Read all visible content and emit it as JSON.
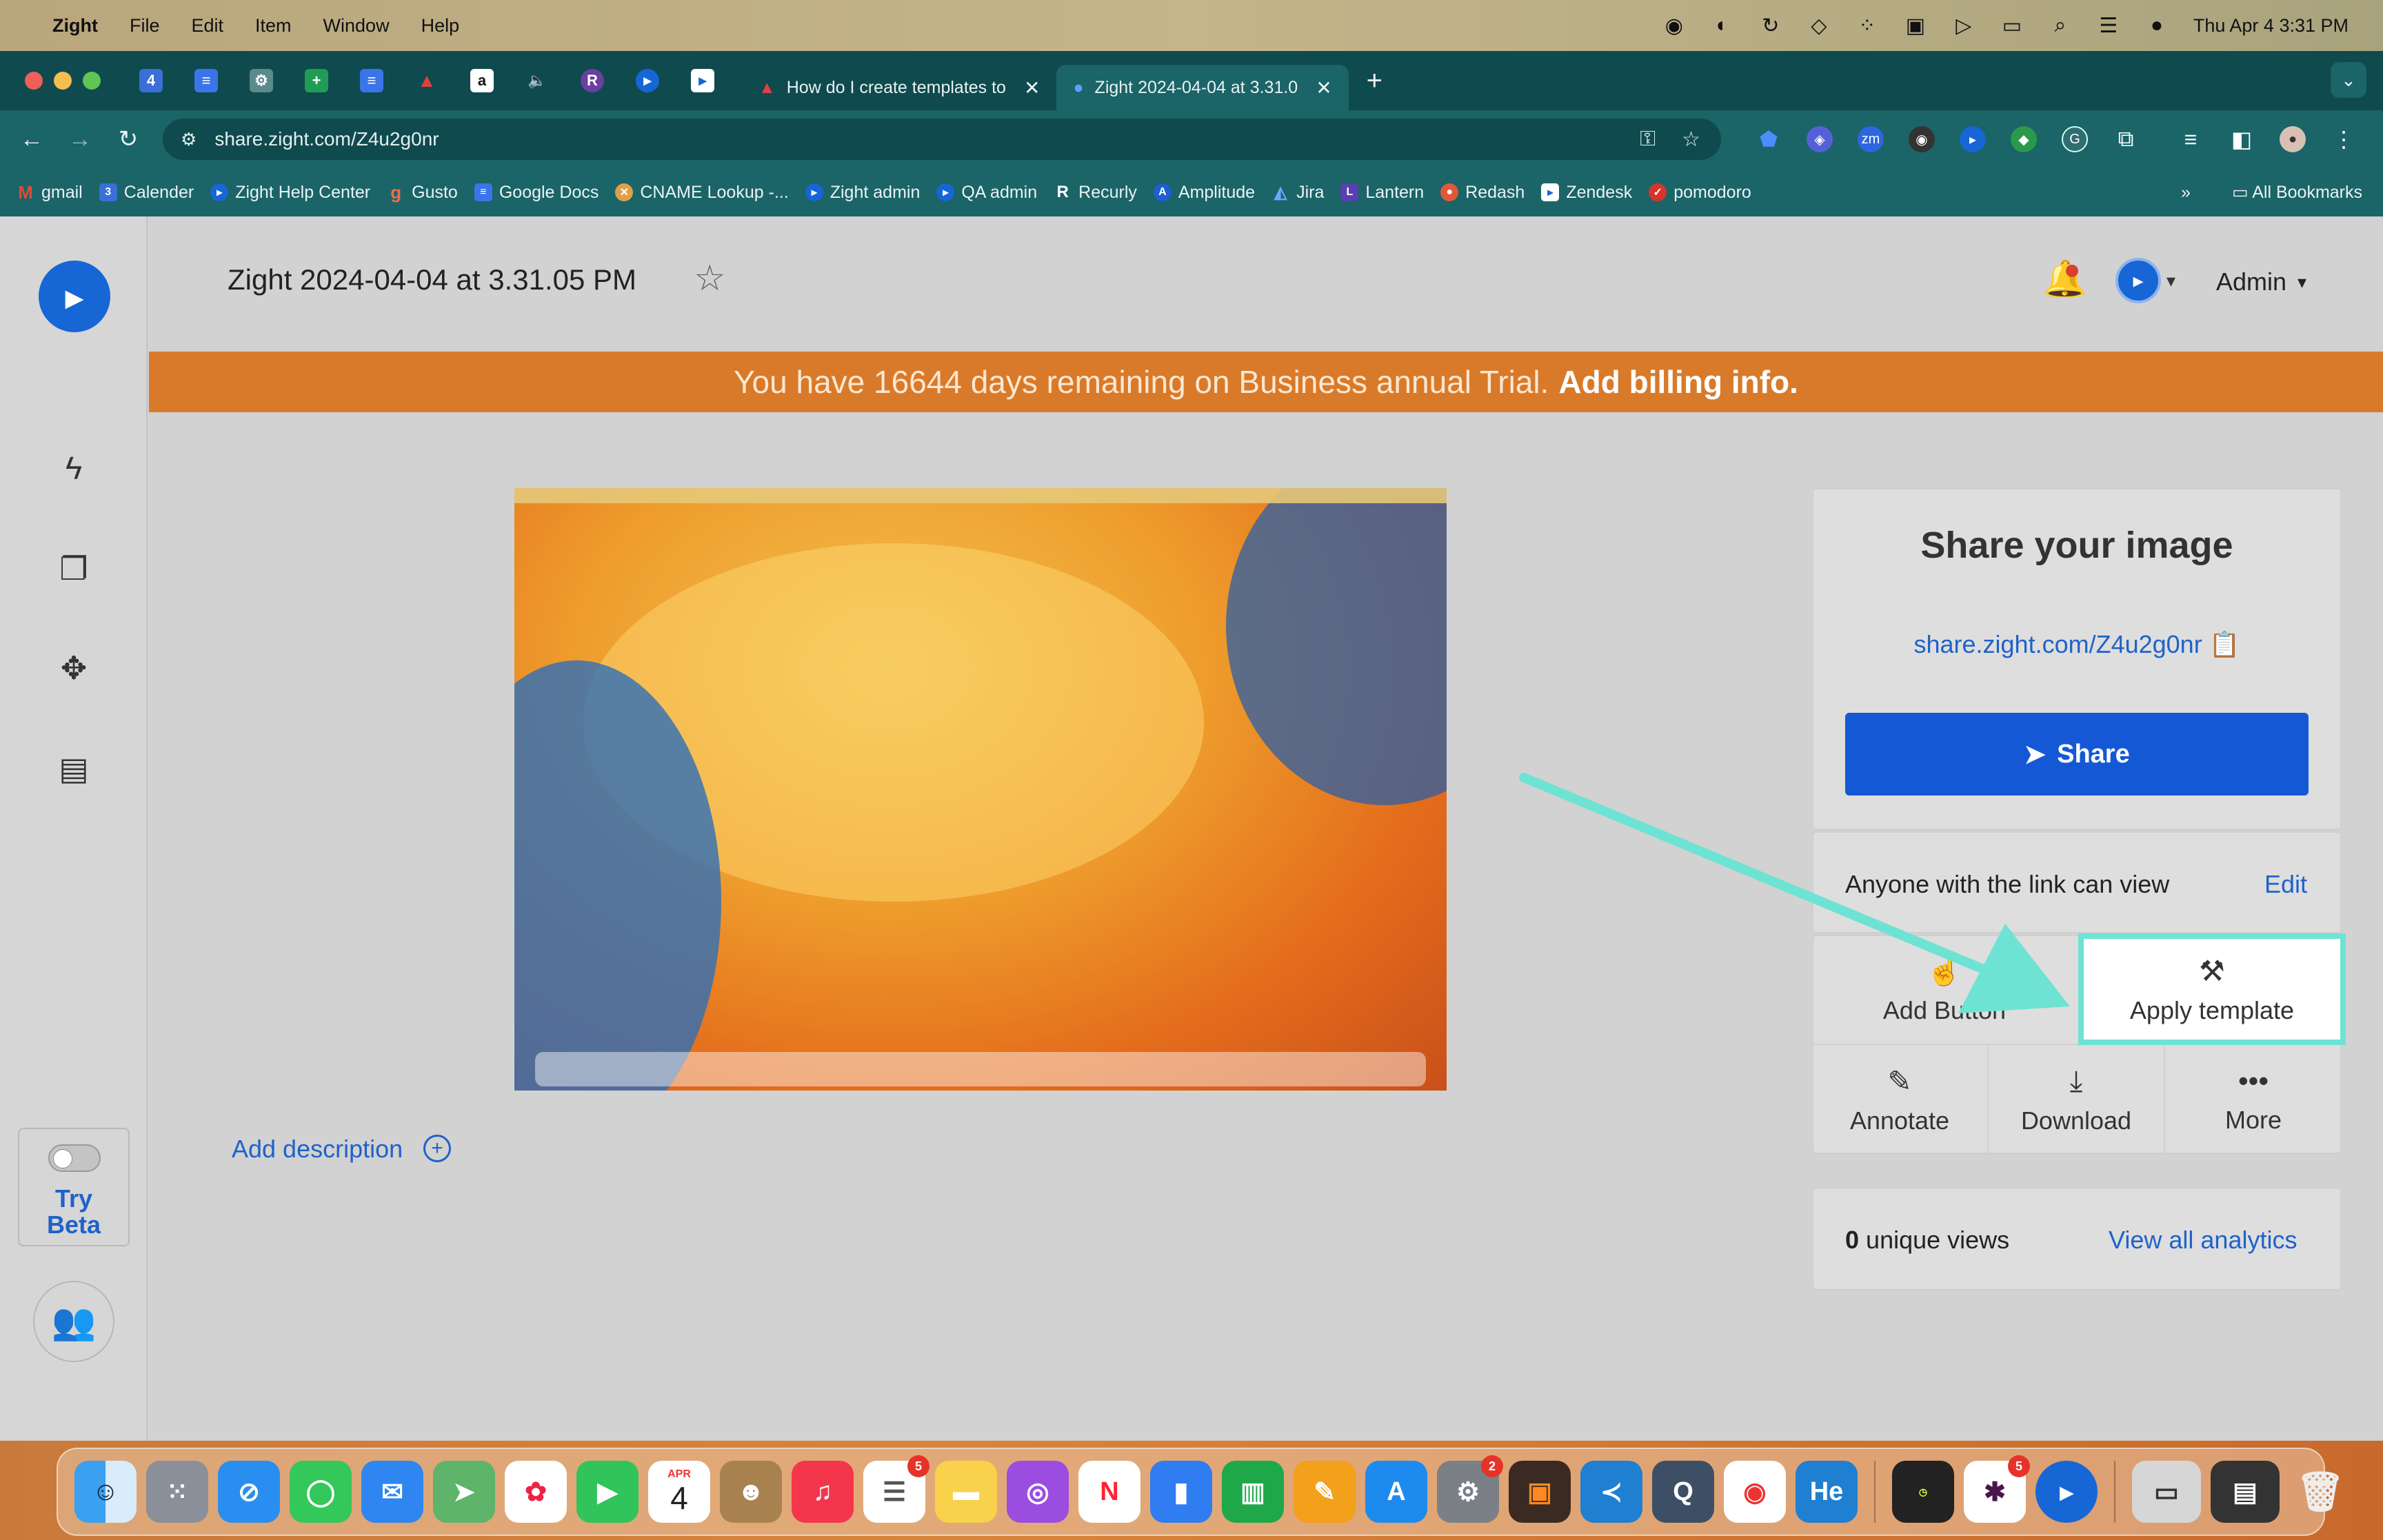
{
  "menubar": {
    "app_name": "Zight",
    "menus": [
      "File",
      "Edit",
      "Item",
      "Window",
      "Help"
    ],
    "datetime": "Thu Apr 4  3:31 PM"
  },
  "browser": {
    "tabs": [
      {
        "label": "How do I create templates to",
        "active": false
      },
      {
        "label": "Zight 2024-04-04 at 3.31.0",
        "active": true
      }
    ],
    "url": "share.zight.com/Z4u2g0nr",
    "bookmarks": [
      "gmail",
      "Calender",
      "Zight Help Center",
      "Gusto",
      "Google Docs",
      "CNAME Lookup -...",
      "Zight admin",
      "QA admin",
      "Recurly",
      "Amplitude",
      "Jira",
      "Lantern",
      "Redash",
      "Zendesk",
      "pomodoro"
    ],
    "all_bookmarks": "All Bookmarks",
    "bookmarks_overflow": "»"
  },
  "header": {
    "title": "Zight 2024-04-04 at 3.31.05 PM",
    "user_label": "Admin"
  },
  "banner": {
    "text": "You have 16644 days remaining on Business annual Trial.",
    "link": "Add billing info."
  },
  "sidebar": {
    "try_beta_line1": "Try",
    "try_beta_line2": "Beta"
  },
  "main": {
    "add_description": "Add description"
  },
  "share_panel": {
    "title": "Share your image",
    "link": "share.zight.com/Z4u2g0nr",
    "share_button": "Share",
    "permission_text": "Anyone with the link can view",
    "edit_link": "Edit",
    "actions": {
      "add_button": "Add Button",
      "apply_template": "Apply template",
      "annotate": "Annotate",
      "download": "Download",
      "more": "More"
    },
    "views_count": "0",
    "views_label": "unique views",
    "analytics_link": "View all analytics"
  },
  "dock": {
    "calendar_month": "APR",
    "calendar_day": "4",
    "badges": {
      "reminders": "5",
      "settings": "2",
      "slack": "5"
    }
  },
  "colors": {
    "accent": "#1558d6",
    "banner": "#d97a2a",
    "highlight": "#6ee3d3"
  }
}
